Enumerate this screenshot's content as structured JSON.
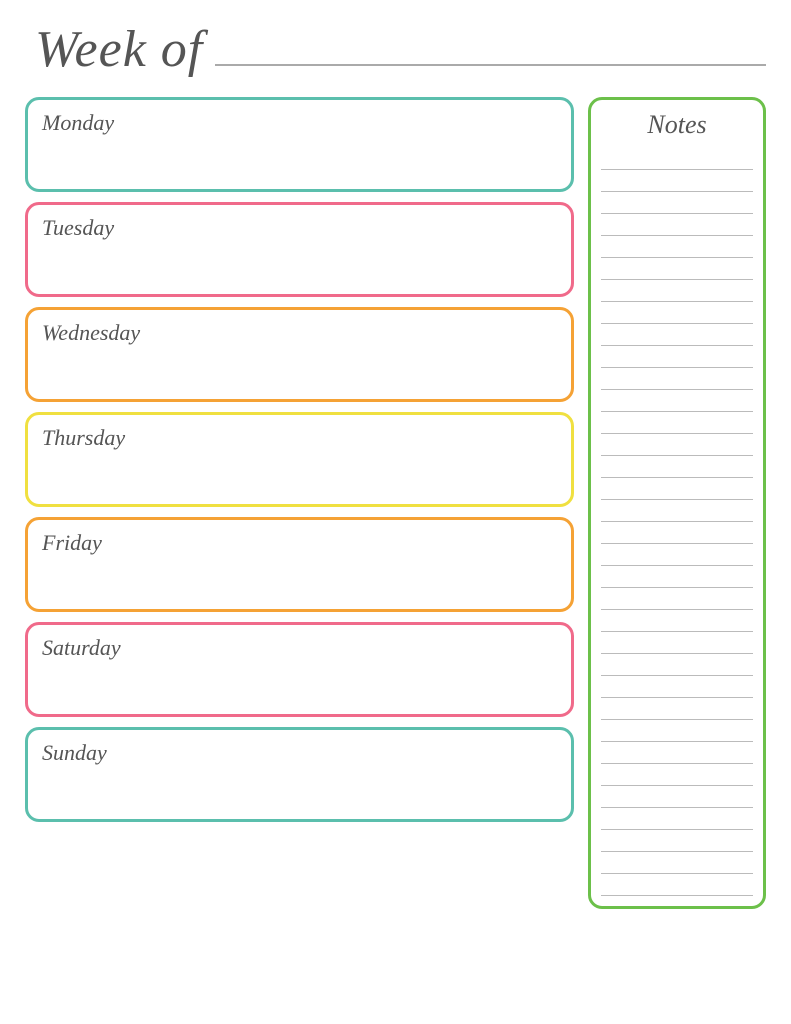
{
  "header": {
    "title": "Week of",
    "line": true
  },
  "days": [
    {
      "id": "monday",
      "label": "Monday",
      "class": "monday"
    },
    {
      "id": "tuesday",
      "label": "Tuesday",
      "class": "tuesday"
    },
    {
      "id": "wednesday",
      "label": "Wednesday",
      "class": "wednesday"
    },
    {
      "id": "thursday",
      "label": "Thursday",
      "class": "thursday"
    },
    {
      "id": "friday",
      "label": "Friday",
      "class": "friday"
    },
    {
      "id": "saturday",
      "label": "Saturday",
      "class": "saturday"
    },
    {
      "id": "sunday",
      "label": "Sunday",
      "class": "sunday"
    }
  ],
  "notes": {
    "label": "Notes",
    "line_count": 34
  }
}
